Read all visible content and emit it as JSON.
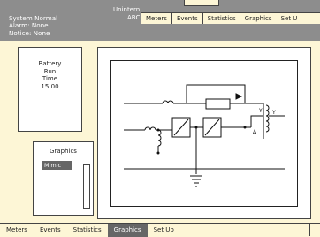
{
  "status": {
    "line1": "System Normal",
    "line2": "Alarm:  None",
    "line3": "Notice: None"
  },
  "title": {
    "line1": "Unintern",
    "line2": "ABC"
  },
  "top_tabs": [
    "Meters",
    "Events",
    "Statistics",
    "Graphics",
    "Set U"
  ],
  "battery": {
    "line1": "Battery",
    "line2": "Run",
    "line3": "Time",
    "line4": "15:00"
  },
  "graphics_panel": {
    "title": "Graphics",
    "mimic_label": "Mimic"
  },
  "bottom_tabs": [
    "Meters",
    "Events",
    "Statistics",
    "Graphics",
    "Set Up"
  ],
  "selected_bottom_tab": "Graphics",
  "colors": {
    "background": "#fdf6d6",
    "header": "#8d8d8d",
    "selected_tab": "#666666"
  }
}
